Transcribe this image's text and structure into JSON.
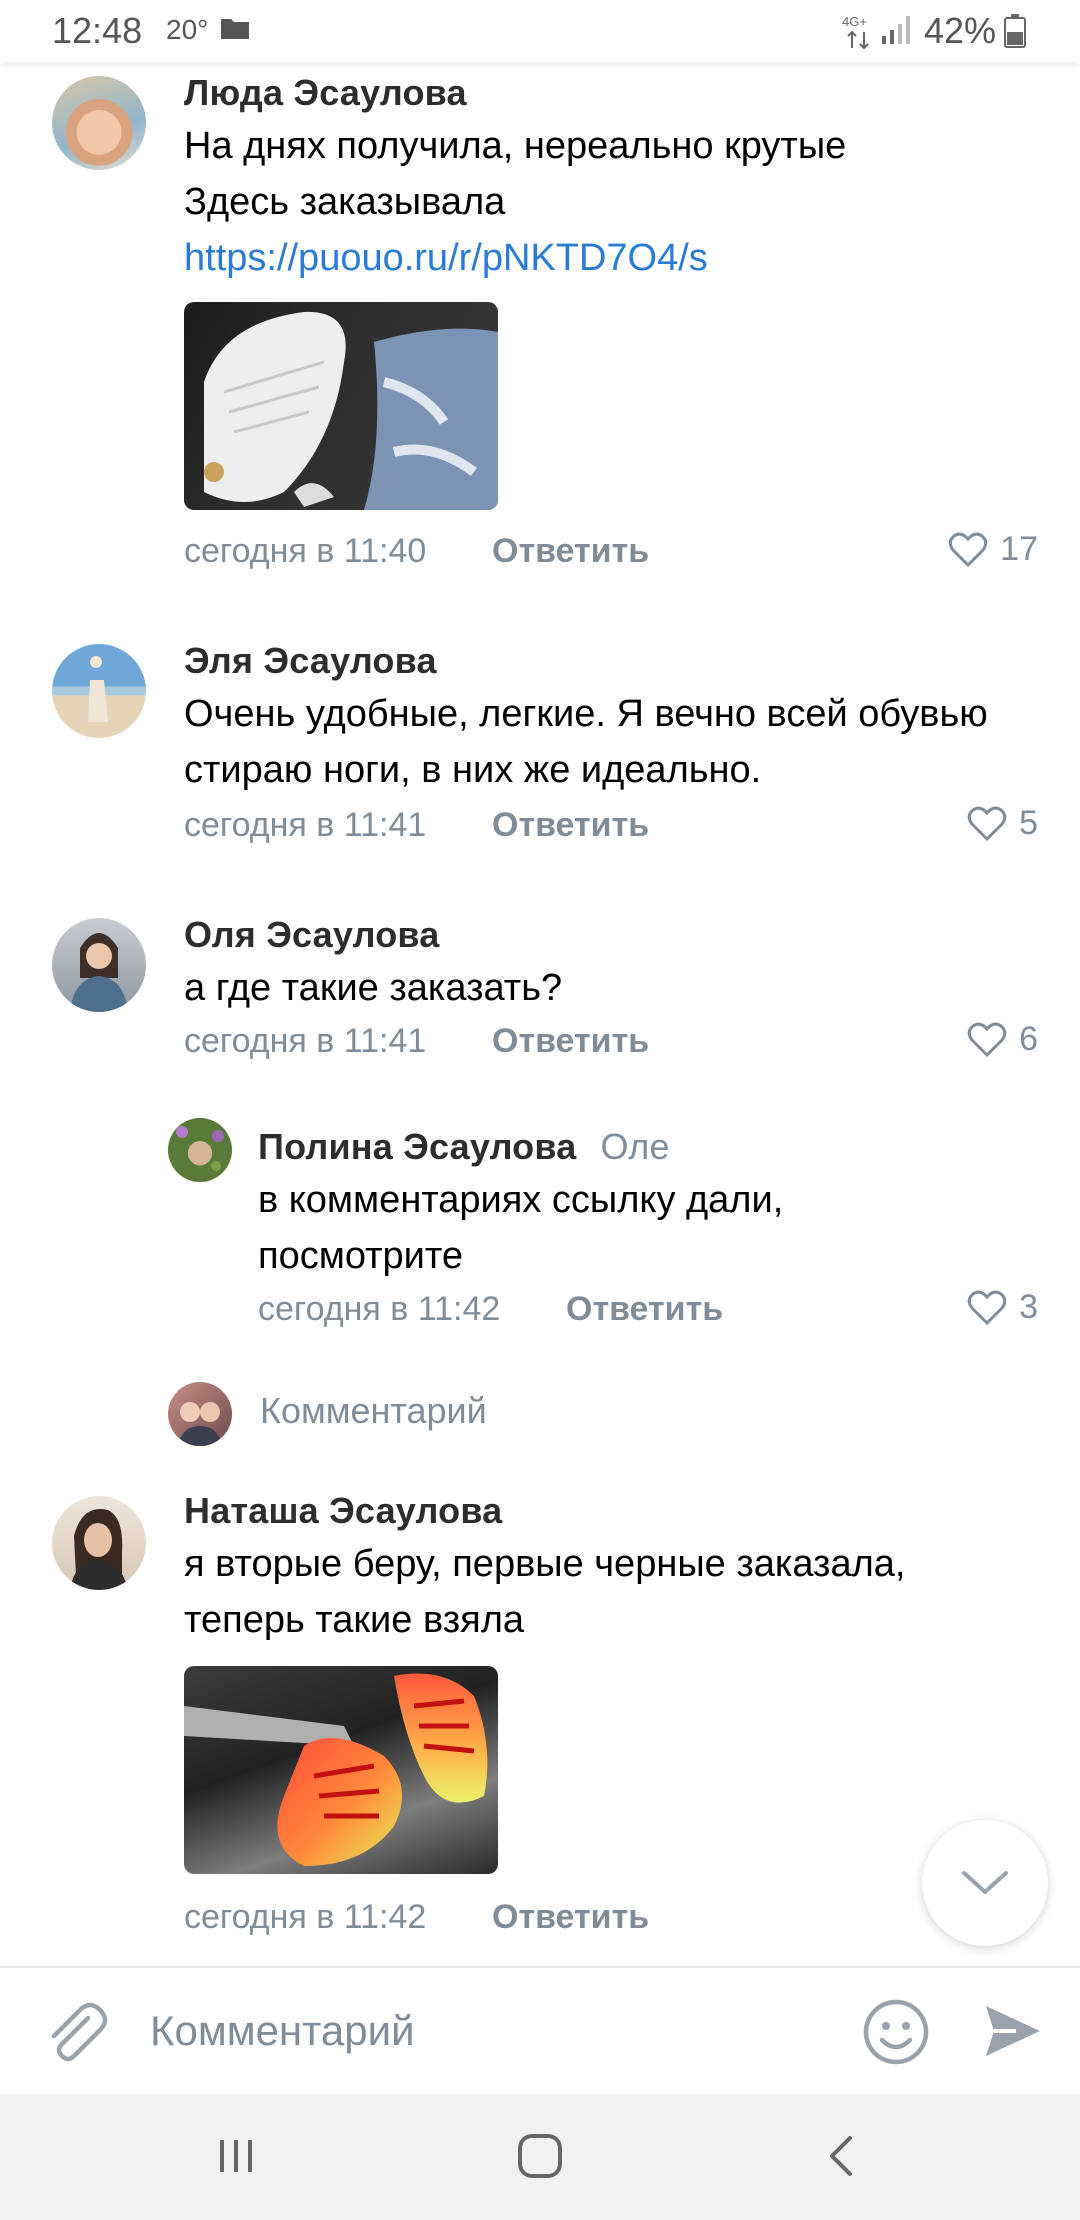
{
  "status_bar": {
    "time": "12:48",
    "temperature": "20°",
    "network": "4G+",
    "battery": "42%"
  },
  "comments": [
    {
      "author": "Люда Эсаулова",
      "text_line1": "На днях получила, нереально крутые",
      "text_prefix": "Здесь заказывала",
      "link": "https://puouo.ru/r/pNKTD7O4/s",
      "time": "сегодня в 11:40",
      "reply_label": "Ответить",
      "likes": "17"
    },
    {
      "author": "Эля Эсаулова",
      "text": "Очень удобные, легкие. Я вечно всей обувью стираю ноги, в них же идеально.",
      "time": "сегодня в 11:41",
      "reply_label": "Ответить",
      "likes": "5"
    },
    {
      "author": "Оля Эсаулова",
      "text": "а где такие заказать?",
      "time": "сегодня в 11:41",
      "reply_label": "Ответить",
      "likes": "6"
    },
    {
      "author": "Полина Эсаулова",
      "reply_to": "Оле",
      "text": "в комментариях ссылку дали, посмотрите",
      "time": "сегодня в 11:42",
      "reply_label": "Ответить",
      "likes": "3"
    },
    {
      "author": "Наташа Эсаулова",
      "text": "я вторые беру, первые черные заказала, теперь такие взяла",
      "time": "сегодня в 11:42",
      "reply_label": "Ответить"
    }
  ],
  "thread_comment_prompt": "Комментарий",
  "input": {
    "placeholder": "Комментарий"
  },
  "colors": {
    "link": "#2a7bd4",
    "secondary_text": "#818c99",
    "accent_icon": "#99a2ad"
  },
  "icons": [
    "folder-icon",
    "network-icon",
    "signal-icon",
    "battery-icon",
    "heart-icon",
    "chevron-down-icon",
    "attach-icon",
    "emoji-icon",
    "send-icon",
    "recents-icon",
    "home-icon",
    "back-icon"
  ]
}
